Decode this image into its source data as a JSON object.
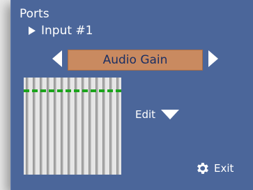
{
  "header": {
    "title": "Ports"
  },
  "breadcrumb": {
    "label": "Input #1"
  },
  "selector": {
    "label": "Audio Gain"
  },
  "faders": {
    "count": 14,
    "gain_level": 0.86
  },
  "edit": {
    "label": "Edit"
  },
  "exit": {
    "label": "Exit"
  },
  "colors": {
    "panel": "#4b669a",
    "selector_bg": "#c98a60",
    "selector_text": "#1b2f63",
    "gain_line": "#1ca41c"
  }
}
